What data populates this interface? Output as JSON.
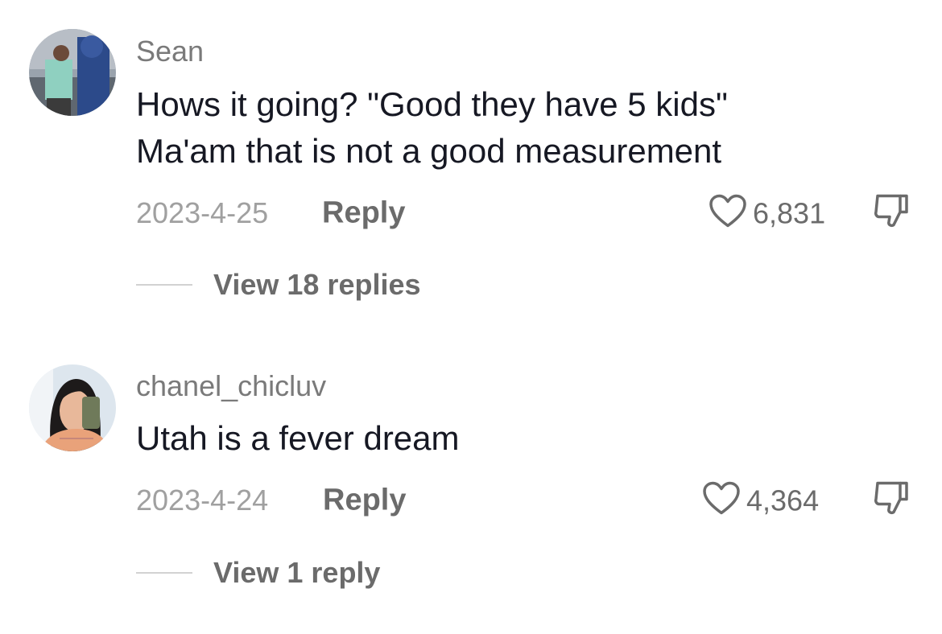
{
  "comments": [
    {
      "username": "Sean",
      "text_lines": [
        "Hows it going? \"Good they have 5 kids\"",
        "Ma'am that is not a good measurement"
      ],
      "date": "2023-4-25",
      "reply_label": "Reply",
      "likes": "6,831",
      "view_replies": "View 18 replies"
    },
    {
      "username": "chanel_chicluv",
      "text_lines": [
        "Utah is a fever dream"
      ],
      "date": "2023-4-24",
      "reply_label": "Reply",
      "likes": "4,364",
      "view_replies": "View 1 reply"
    }
  ],
  "icons": {
    "like": "heart-outline-icon",
    "dislike": "thumbs-down-outline-icon"
  },
  "colors": {
    "text": "#161823",
    "muted": "#7a7a7a",
    "date": "#a0a0a0",
    "action": "#6b6b6b",
    "divider": "#d2d2d2",
    "background": "#ffffff"
  }
}
